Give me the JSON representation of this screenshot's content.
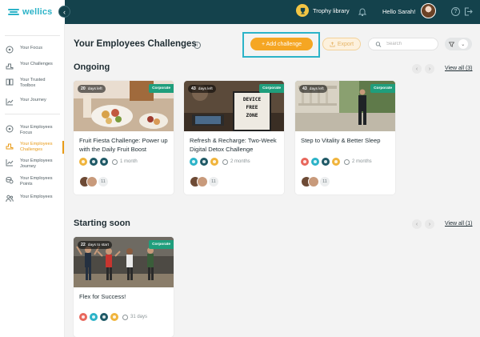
{
  "app": {
    "brand": "wellics"
  },
  "header": {
    "trophy_label": "Trophy library",
    "greeting": "Hello Sarah!"
  },
  "sidebar": {
    "items": [
      {
        "label": "Your Focus",
        "icon": "target-icon"
      },
      {
        "label": "Your Challenges",
        "icon": "podium-icon"
      },
      {
        "label": "Your Trusted Toolbox",
        "icon": "book-icon"
      },
      {
        "label": "Your Journey",
        "icon": "chart-line-icon"
      },
      {
        "label": "Your Employees Focus",
        "icon": "target-icon"
      },
      {
        "label": "Your Employees Challenges",
        "icon": "podium-icon",
        "active": true
      },
      {
        "label": "Your Employees Journey",
        "icon": "chart-line-icon"
      },
      {
        "label": "Your Employees Points",
        "icon": "coins-icon"
      },
      {
        "label": "Your Employees",
        "icon": "users-icon"
      }
    ]
  },
  "main": {
    "title": "Your Employees Challenges",
    "add_label": "+ Add challenge",
    "export_label": "Export",
    "search_placeholder": "Search"
  },
  "ongoing": {
    "title": "Ongoing",
    "view_all": "View all (3)",
    "cards": [
      {
        "days": "20",
        "days_label": "days left",
        "badge": "Corporate",
        "title": "Fruit Fiesta Challenge: Power up with the Daily Fruit Boost",
        "duration": "1 month",
        "count": "11"
      },
      {
        "days": "43",
        "days_label": "days left",
        "badge": "Corporate",
        "title": "Refresh & Recharge: Two-Week Digital Detox Challenge",
        "duration": "2 months",
        "count": "11",
        "sign": [
          "DEVICE",
          "FREE",
          "ZONE"
        ]
      },
      {
        "days": "43",
        "days_label": "days left",
        "badge": "Corporate",
        "title": "Step to Vitality & Better Sleep",
        "duration": "2 months",
        "count": "11"
      }
    ]
  },
  "starting": {
    "title": "Starting soon",
    "view_all": "View all (1)",
    "cards": [
      {
        "days": "22",
        "days_label": "days to start",
        "badge": "Corporate",
        "title": "Flex for Success!",
        "duration": "31 days"
      }
    ]
  },
  "colors": {
    "accent": "#f5a623",
    "primary": "#14424c",
    "teal": "#2cb3c8",
    "corporate": "#1f9e7c"
  }
}
